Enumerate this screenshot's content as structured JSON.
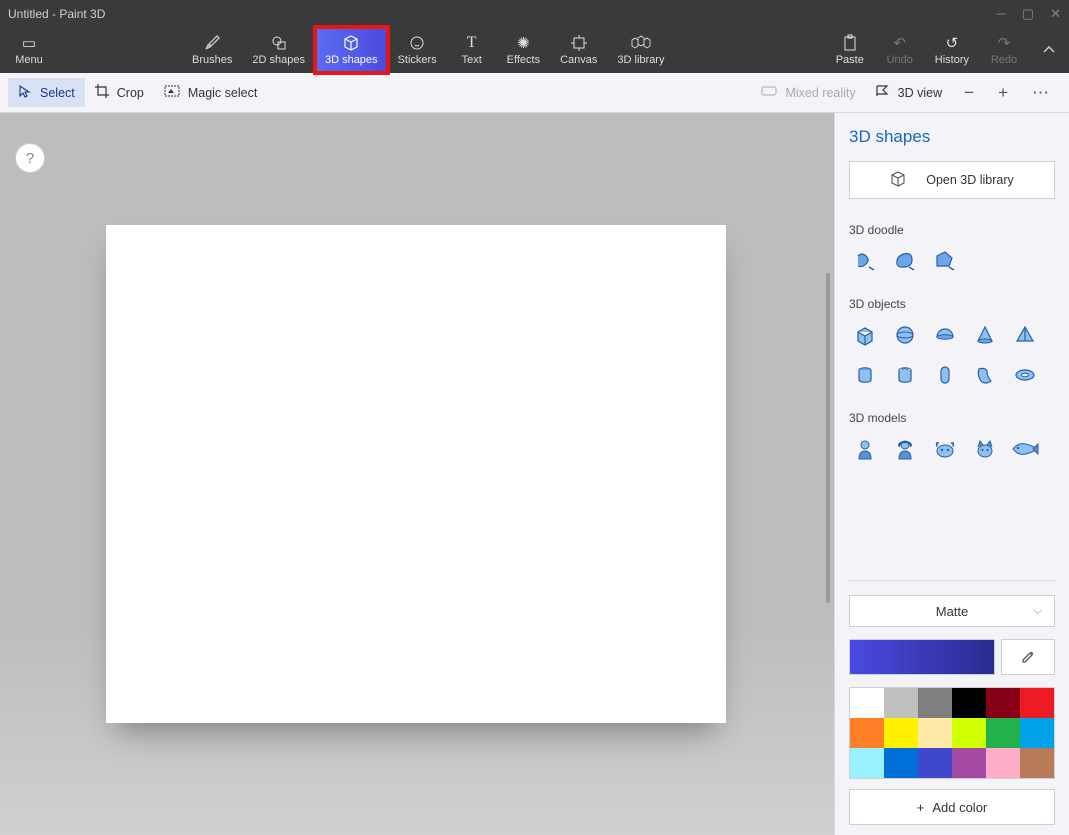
{
  "window": {
    "title": "Untitled - Paint 3D"
  },
  "ribbon": {
    "menu": "Menu",
    "brushes": "Brushes",
    "shapes2d": "2D shapes",
    "shapes3d": "3D shapes",
    "stickers": "Stickers",
    "text": "Text",
    "effects": "Effects",
    "canvas": "Canvas",
    "library3d": "3D library",
    "paste": "Paste",
    "undo": "Undo",
    "history": "History",
    "redo": "Redo"
  },
  "subbar": {
    "select": "Select",
    "crop": "Crop",
    "magic": "Magic select",
    "mixed": "Mixed reality",
    "view3d": "3D view"
  },
  "panel": {
    "title": "3D shapes",
    "open_library": "Open 3D library",
    "sections": {
      "doodle": "3D doodle",
      "objects": "3D objects",
      "models": "3D models"
    },
    "doodle_items": [
      "tube-doodle",
      "soft-doodle",
      "sharp-doodle"
    ],
    "object_items": [
      "cube",
      "sphere",
      "hemisphere",
      "cone",
      "pyramid",
      "cylinder",
      "tube",
      "capsule",
      "curved-cylinder",
      "donut"
    ],
    "model_items": [
      "man",
      "woman",
      "dog",
      "cat",
      "fish"
    ],
    "material": "Matte",
    "main_color": "#4a4ae0",
    "palette": [
      "#ffffff",
      "#c0c0c0",
      "#7f7f7f",
      "#000000",
      "#880015",
      "#ed1c24",
      "#ff7f27",
      "#fff200",
      "#ffe9a6",
      "#d0ff00",
      "#22b14c",
      "#00a2e8",
      "#99f2ff",
      "#0070d8",
      "#3f48cc",
      "#a349a4",
      "#ffaec9",
      "#b97a57"
    ],
    "add_color": "Add color"
  }
}
